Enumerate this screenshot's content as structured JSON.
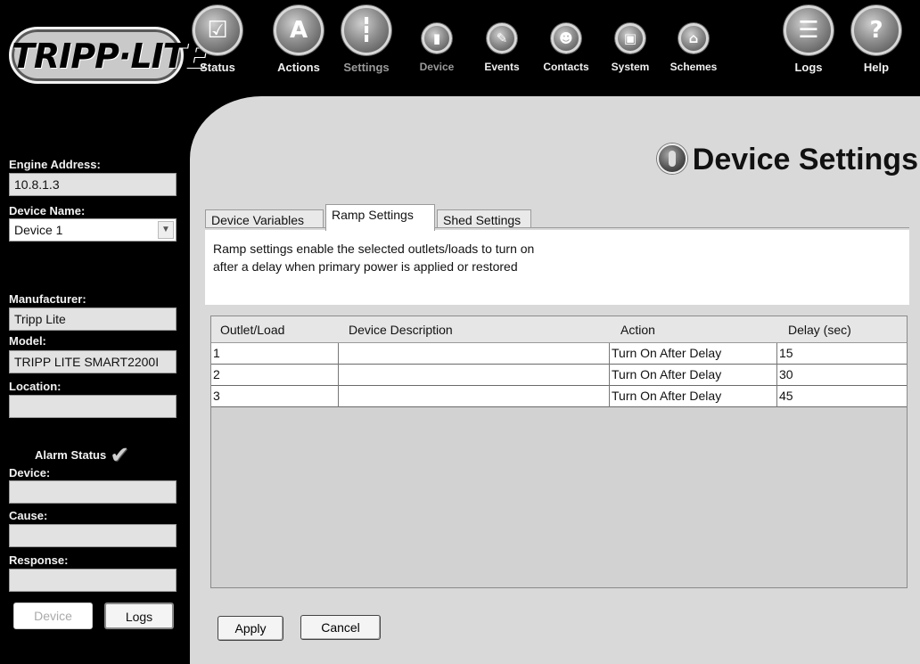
{
  "brand": {
    "logo_text": "TRIPP·LITE"
  },
  "nav": {
    "items": [
      {
        "label": "Status",
        "icon": "checkbox-icon"
      },
      {
        "label": "Actions",
        "icon": "actions-icon"
      },
      {
        "label": "Settings",
        "icon": "settings-sliders-icon"
      },
      {
        "label": "Device",
        "icon": "device-icon"
      },
      {
        "label": "Events",
        "icon": "events-icon"
      },
      {
        "label": "Contacts",
        "icon": "contacts-icon"
      },
      {
        "label": "System",
        "icon": "system-icon"
      },
      {
        "label": "Schemes",
        "icon": "schemes-icon"
      },
      {
        "label": "Logs",
        "icon": "logs-icon"
      },
      {
        "label": "Help",
        "icon": "help-icon"
      }
    ]
  },
  "sidebar": {
    "engine_address_label": "Engine Address:",
    "engine_address_value": "10.8.1.3",
    "device_name_label": "Device Name:",
    "device_name_value": "Device 1",
    "manufacturer_label": "Manufacturer:",
    "manufacturer_value": "Tripp Lite",
    "model_label": "Model:",
    "model_value": "TRIPP LITE SMART2200I",
    "location_label": "Location:",
    "location_value": "",
    "alarm_status_label": "Alarm Status",
    "device_label": "Device:",
    "device_value": "",
    "cause_label": "Cause:",
    "cause_value": "",
    "response_label": "Response:",
    "response_value": "",
    "device_button": "Device",
    "logs_button": "Logs"
  },
  "page": {
    "title": "Device Settings",
    "tabs": [
      {
        "label": "Device Variables",
        "active": false
      },
      {
        "label": "Ramp Settings",
        "active": true
      },
      {
        "label": "Shed Settings",
        "active": false
      }
    ],
    "description_line1": "Ramp settings enable the selected outlets/loads to turn on",
    "description_line2": "after a delay when primary power is applied or restored"
  },
  "table": {
    "columns": [
      "Outlet/Load",
      "Device Description",
      "Action",
      "Delay (sec)"
    ],
    "rows": [
      [
        "1",
        "",
        "Turn On After Delay",
        "15"
      ],
      [
        "2",
        "",
        "Turn On After Delay",
        "30"
      ],
      [
        "3",
        "",
        "Turn On After Delay",
        "45"
      ]
    ]
  },
  "actions": {
    "apply": "Apply",
    "cancel": "Cancel"
  }
}
